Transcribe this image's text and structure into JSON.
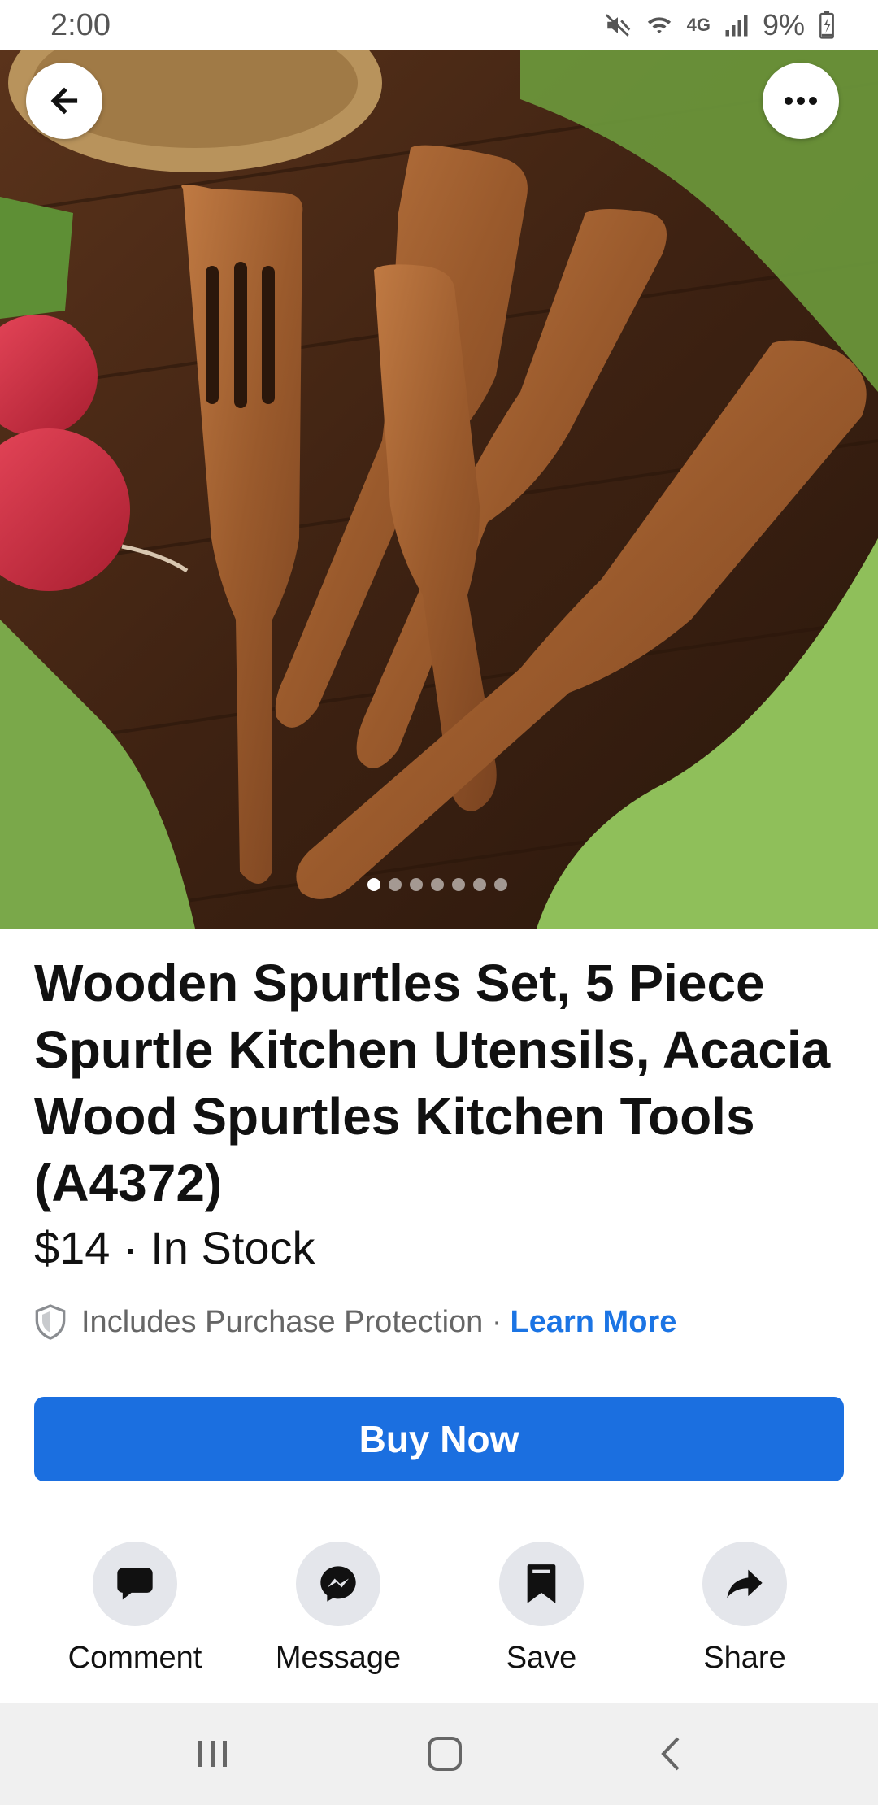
{
  "status_bar": {
    "time": "2:00",
    "battery": "9%",
    "network": "4G"
  },
  "gallery": {
    "image_count": 7,
    "active_index": 0
  },
  "product": {
    "title": "Wooden Spurtles Set, 5 Piece Spurtle Kitchen Utensils, Acacia Wood Spurtles Kitchen Tools  (A4372)",
    "price_line": "$14 · In Stock"
  },
  "protection": {
    "text": "Includes Purchase Protection ·",
    "link": "Learn More"
  },
  "buy_button": {
    "label": "Buy Now"
  },
  "actions": [
    {
      "label": "Comment",
      "icon": "comment-icon"
    },
    {
      "label": "Message",
      "icon": "messenger-icon"
    },
    {
      "label": "Save",
      "icon": "bookmark-icon"
    },
    {
      "label": "Share",
      "icon": "share-icon"
    }
  ],
  "colors": {
    "accent": "#1b6fe0",
    "link": "#1b74e4",
    "action_bg": "#e4e6eb"
  }
}
